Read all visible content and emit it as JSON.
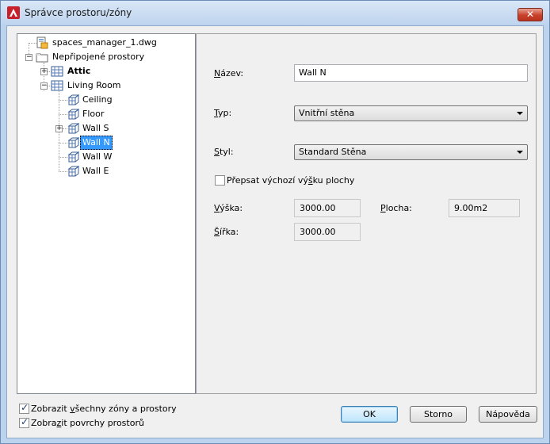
{
  "window": {
    "title": "Správce prostoru/zóny",
    "close_label": "✕"
  },
  "tree": {
    "root": "spaces_manager_1.dwg",
    "group": "Nepřipojené prostory",
    "items": [
      {
        "label": "Attic",
        "bold": true
      },
      {
        "label": "Living Room"
      },
      {
        "label": "Ceiling"
      },
      {
        "label": "Floor"
      },
      {
        "label": "Wall S"
      },
      {
        "label": "Wall N",
        "selected": true
      },
      {
        "label": "Wall W"
      },
      {
        "label": "Wall E"
      }
    ]
  },
  "form": {
    "name_label_u": "N",
    "name_label_rest": "ázev:",
    "name_value": "Wall N",
    "type_label_u": "T",
    "type_label_rest": "yp:",
    "type_value": "Vnitřní stěna",
    "style_label_u": "S",
    "style_label_rest": "tyl:",
    "style_value": "Standard Stěna",
    "override_label_pre": "Přepsat výchozí vý",
    "override_label_u": "š",
    "override_label_post": "ku plochy",
    "height_label_u": "V",
    "height_label_rest": "ýška:",
    "height_value": "3000.00",
    "area_label_u": "P",
    "area_label_rest": "locha:",
    "area_value": "9.00m2",
    "width_label_u": "Š",
    "width_label_rest": "ířka:",
    "width_value": "3000.00"
  },
  "options": {
    "show_all_pre": "Zobrazit ",
    "show_all_u": "v",
    "show_all_post": "šechny zóny a prostory",
    "show_surfaces_pre": "Zobra",
    "show_surfaces_u": "z",
    "show_surfaces_post": "it povrchy prostorů"
  },
  "buttons": {
    "ok": "OK",
    "cancel": "Storno",
    "help": "Nápověda"
  },
  "colors": {
    "selection": "#3399ff",
    "close_button": "#c8402a"
  }
}
